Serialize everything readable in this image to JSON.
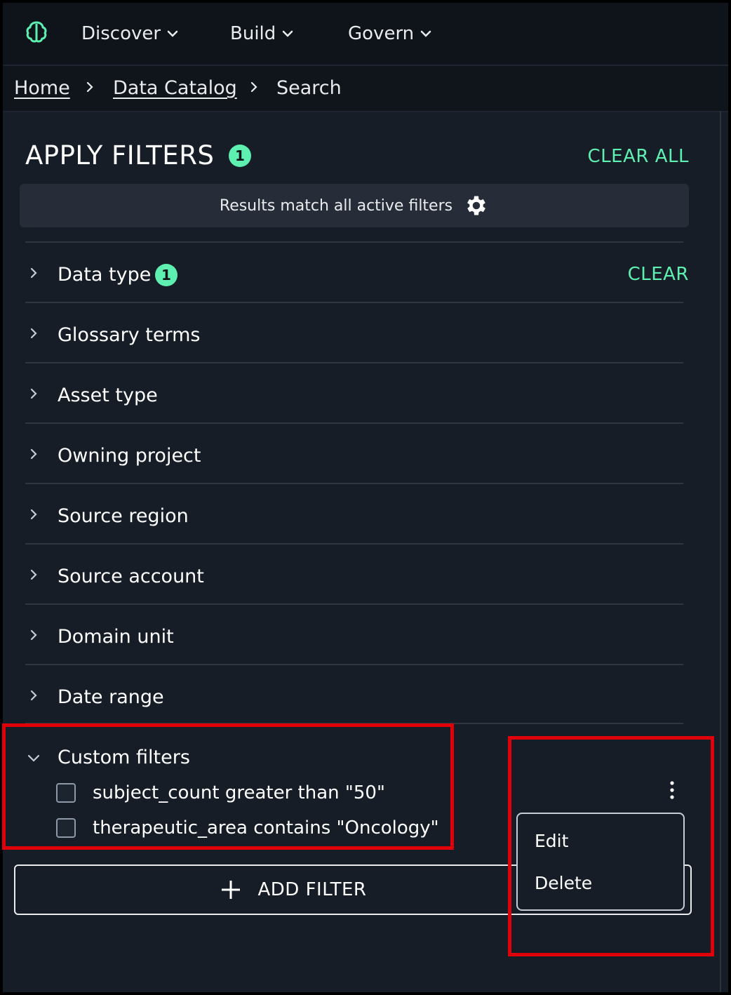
{
  "nav": {
    "items": [
      {
        "label": "Discover"
      },
      {
        "label": "Build"
      },
      {
        "label": "Govern"
      }
    ]
  },
  "breadcrumb": {
    "home": "Home",
    "catalog": "Data Catalog",
    "current": "Search"
  },
  "filters": {
    "title": "APPLY FILTERS",
    "active_count": "1",
    "clear_all": "CLEAR ALL",
    "match_text": "Results match all active filters",
    "sections": [
      {
        "label": "Data type",
        "count": "1",
        "clear": "CLEAR"
      },
      {
        "label": "Glossary terms"
      },
      {
        "label": "Asset type"
      },
      {
        "label": "Owning project"
      },
      {
        "label": "Source region"
      },
      {
        "label": "Source account"
      },
      {
        "label": "Domain unit"
      },
      {
        "label": "Date range"
      }
    ],
    "custom": {
      "label": "Custom filters",
      "items": [
        {
          "label": "subject_count greater than \"50\"",
          "checked": false
        },
        {
          "label": "therapeutic_area contains \"Oncology\"",
          "checked": false
        }
      ]
    },
    "add_filter": "ADD FILTER"
  },
  "context_menu": {
    "items": [
      {
        "label": "Edit"
      },
      {
        "label": "Delete"
      }
    ]
  },
  "colors": {
    "accent": "#5ef0b0",
    "highlight": "#e0000a",
    "background": "#161d26"
  }
}
